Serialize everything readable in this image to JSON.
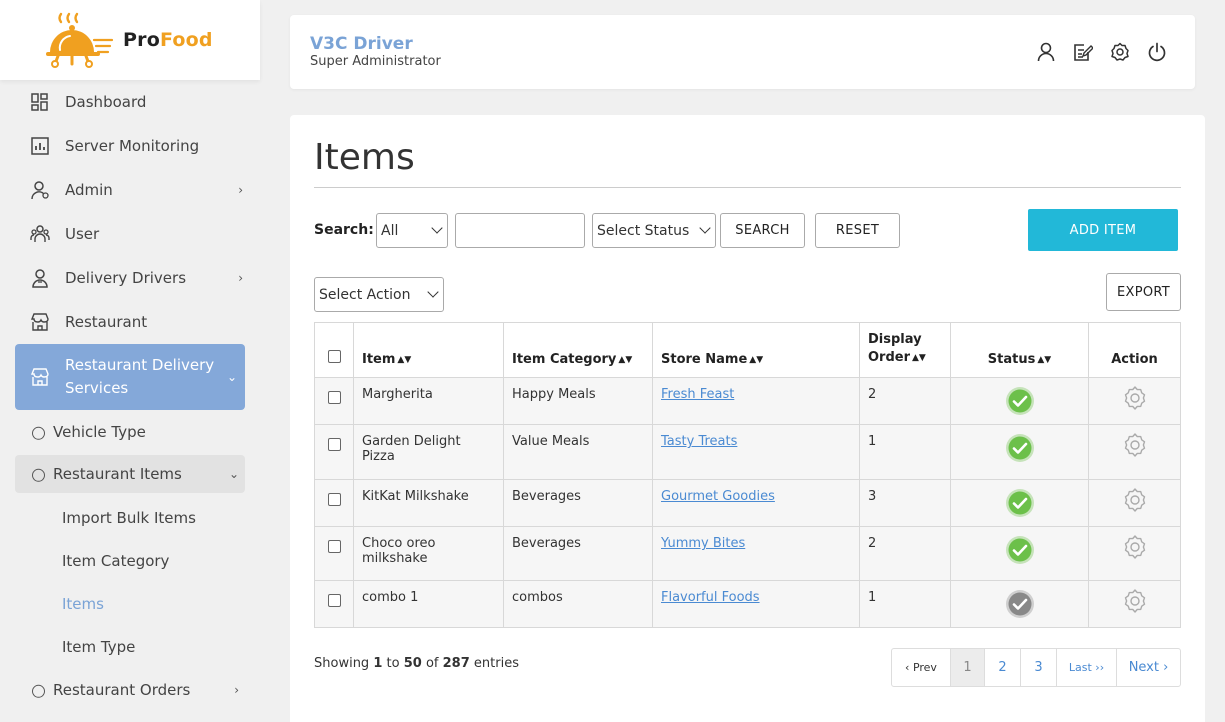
{
  "brand": {
    "pro": "Pro",
    "food": "Food"
  },
  "sidebar": {
    "items": [
      {
        "label": "Dashboard",
        "icon": "dashboard-icon"
      },
      {
        "label": "Server Monitoring",
        "icon": "chart-icon"
      },
      {
        "label": "Admin",
        "icon": "admin-user-icon",
        "has_children": true
      },
      {
        "label": "User",
        "icon": "users-icon"
      },
      {
        "label": "Delivery Drivers",
        "icon": "driver-icon",
        "has_children": true
      },
      {
        "label": "Restaurant",
        "icon": "store-icon"
      },
      {
        "label": "Restaurant Delivery Services",
        "icon": "store-icon",
        "active": true
      }
    ],
    "sub_items": [
      {
        "label": "Vehicle Type"
      },
      {
        "label": "Restaurant Items",
        "open": true
      },
      {
        "label": "Restaurant Orders"
      }
    ],
    "subsub_items": [
      {
        "label": "Import Bulk Items"
      },
      {
        "label": "Item Category"
      },
      {
        "label": "Items",
        "current": true
      },
      {
        "label": "Item Type"
      }
    ]
  },
  "header": {
    "title": "V3C Driver",
    "subtitle": "Super Administrator",
    "icons": [
      "profile-icon",
      "edit-icon",
      "settings-icon",
      "power-icon"
    ]
  },
  "main": {
    "title": "Items",
    "search_label": "Search:",
    "search_field_select": "All",
    "search_input_value": "",
    "status_select": "Select Status",
    "search_button": "SEARCH",
    "reset_button": "RESET",
    "add_button": "ADD ITEM",
    "action_select": "Select Action",
    "export_button": "EXPORT"
  },
  "table": {
    "columns": {
      "item": "Item",
      "category": "Item Category",
      "store": "Store Name",
      "order_line1": "Display",
      "order_line2": "Order",
      "status": "Status",
      "action": "Action"
    },
    "rows": [
      {
        "item": "Margherita",
        "category": "Happy Meals",
        "store": "Fresh Feast",
        "order": "2",
        "status": "active"
      },
      {
        "item": "Garden Delight Pizza",
        "category": "Value Meals",
        "store": "Tasty Treats",
        "order": "1",
        "status": "active"
      },
      {
        "item": "KitKat Milkshake",
        "category": "Beverages",
        "store": "Gourmet Goodies",
        "order": "3",
        "status": "active"
      },
      {
        "item": "Choco oreo milkshake",
        "category": "Beverages",
        "store": "Yummy Bites",
        "order": "2",
        "status": "active"
      },
      {
        "item": "combo 1",
        "category": "combos",
        "store": "Flavorful Foods",
        "order": "1",
        "status": "inactive"
      }
    ]
  },
  "footer": {
    "showing_prefix": "Showing",
    "from": "1",
    "to_word": "to",
    "to": "50",
    "of_word": "of",
    "total": "287",
    "suffix": "entries"
  },
  "pagination": {
    "prev": "‹ Prev",
    "pages": [
      "1",
      "2",
      "3"
    ],
    "last": "Last ››",
    "next": "Next ›"
  },
  "colors": {
    "accent": "#7aa3d6",
    "active_nav": "#84a8d9",
    "primary_button": "#22b8d8",
    "status_active": "#6cc04a",
    "status_inactive": "#888888",
    "brand_orange": "#f0a020"
  }
}
